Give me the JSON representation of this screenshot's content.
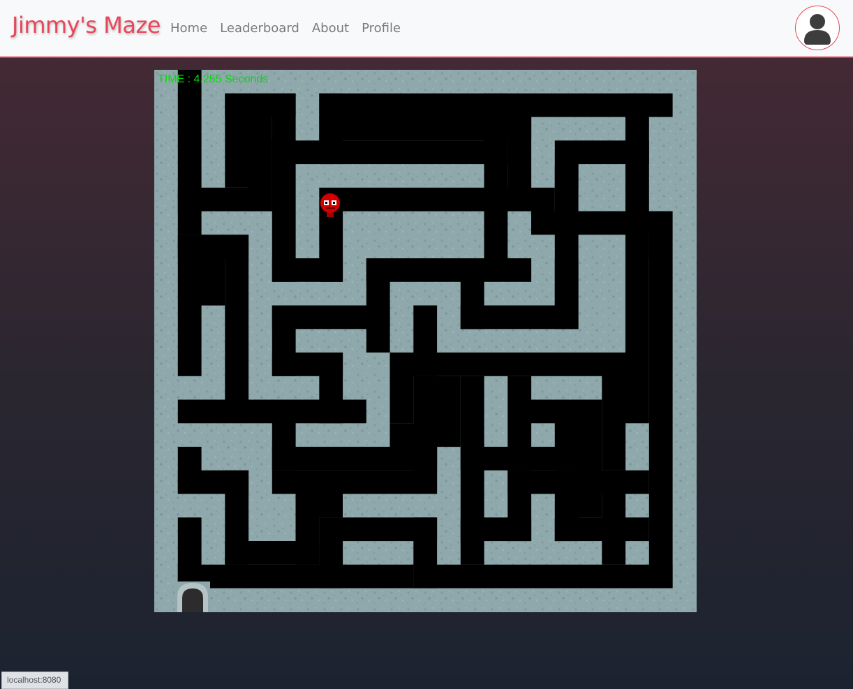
{
  "navbar": {
    "brand": "Jimmy's Maze",
    "links": [
      "Home",
      "Leaderboard",
      "About",
      "Profile"
    ],
    "avatar_icon": "user-avatar-icon"
  },
  "game": {
    "timer_text": "TIME : 4.255 Seconds",
    "player_icon": "red-robot-icon",
    "exit_icon": "arch-door-icon",
    "colors": {
      "floor": "#8fa8ab",
      "wall": "#000000",
      "timer": "#00e000",
      "player": "#d40000"
    }
  },
  "status_bar": {
    "url": "localhost:8080"
  }
}
